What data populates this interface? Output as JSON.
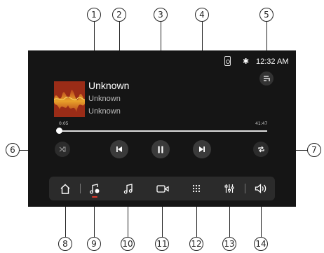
{
  "status": {
    "time": "12:32 AM",
    "bluetooth_glyph": "✱"
  },
  "track": {
    "title": "Unknown",
    "artist": "Unknown",
    "album": "Unknown",
    "elapsed": "0:05",
    "total": "41:47",
    "progress": 0.002
  },
  "controls": {
    "shuffle": "shuffle-icon",
    "previous": "skip-previous-icon",
    "play_pause": "pause-icon",
    "next": "skip-next-icon",
    "repeat": "repeat-icon",
    "playlist": "playlist-icon"
  },
  "nav": {
    "items": [
      "home-icon",
      "music-source-icon",
      "music-note-icon",
      "video-icon",
      "apps-grid-icon",
      "equalizer-icon",
      "volume-icon"
    ],
    "active": "music-source-icon"
  },
  "callouts": [
    "1",
    "2",
    "3",
    "4",
    "5",
    "6",
    "7",
    "8",
    "9",
    "10",
    "11",
    "12",
    "13",
    "14"
  ],
  "colors": {
    "screen_bg": "#151515",
    "navbar_bg": "#2b2b2b",
    "accent": "#e0392b"
  }
}
